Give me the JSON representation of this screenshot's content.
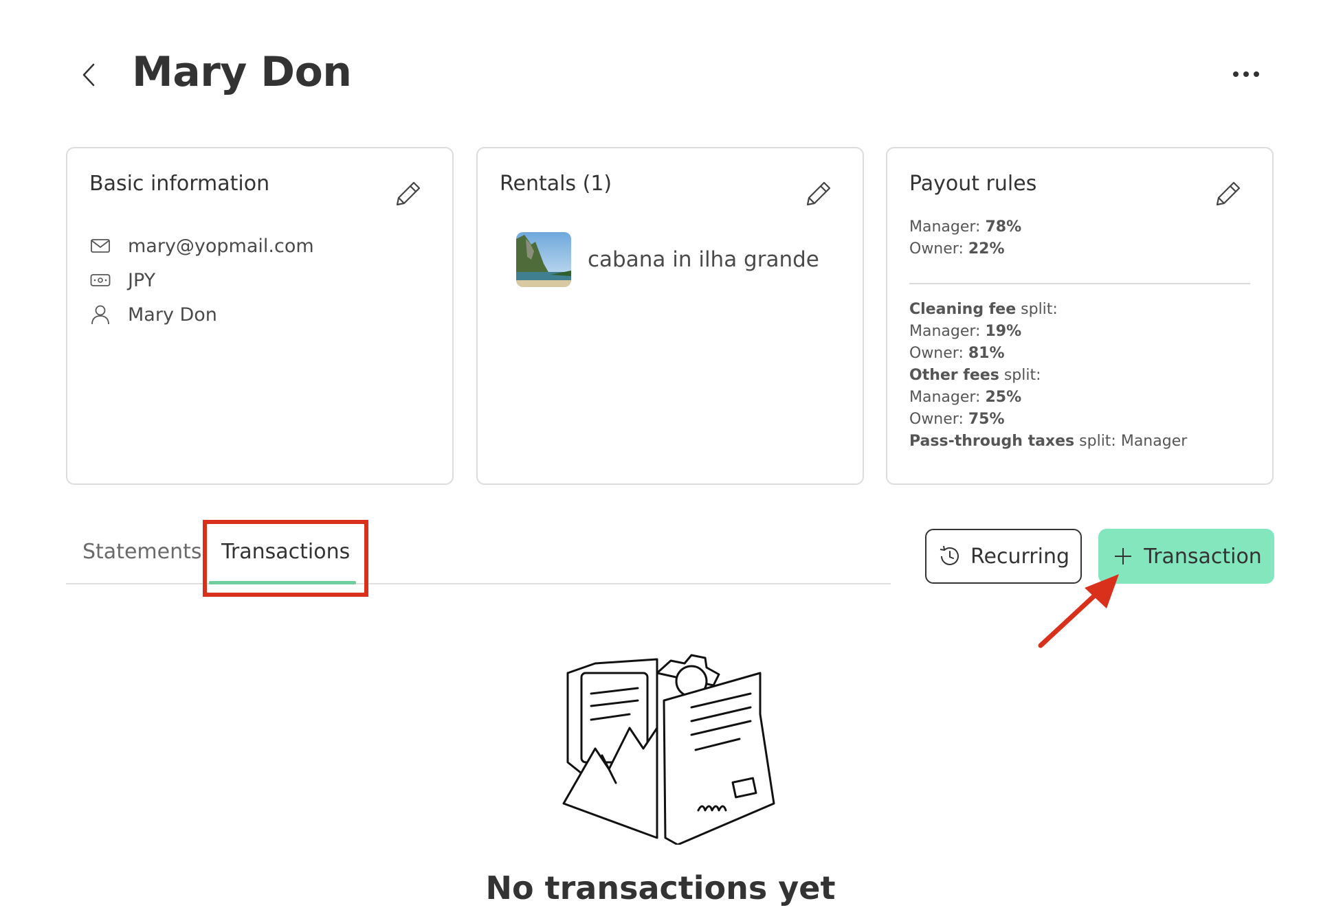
{
  "header": {
    "title": "Mary Don",
    "back_icon": "chevron-left-icon",
    "more_icon": "more-horizontal-icon"
  },
  "cards": {
    "basic": {
      "title": "Basic information",
      "email": "mary@yopmail.com",
      "currency": "JPY",
      "name": "Mary Don"
    },
    "rentals": {
      "title": "Rentals (1)",
      "items": [
        {
          "name": "cabana in ilha grande"
        }
      ]
    },
    "payout": {
      "title": "Payout rules",
      "manager_label": "Manager:",
      "manager_value": "78%",
      "owner_label": "Owner:",
      "owner_value": "22%",
      "cleaning_label": "Cleaning fee",
      "split_suffix": "split:",
      "cleaning_manager_value": "19%",
      "cleaning_owner_value": "81%",
      "other_label": "Other fees",
      "other_manager_value": "25%",
      "other_owner_value": "75%",
      "passthrough_label": "Pass-through taxes",
      "passthrough_value": "split: Manager"
    }
  },
  "tabs": [
    {
      "label": "Statements",
      "active": false
    },
    {
      "label": "Transactions",
      "active": true
    }
  ],
  "actions": {
    "recurring_label": "Recurring",
    "transaction_label": "Transaction"
  },
  "empty_state": {
    "title": "No transactions yet"
  },
  "colors": {
    "accent_green": "#84e6bd",
    "tab_underline": "#6dcf9e",
    "annotation_red": "#d9301c"
  }
}
